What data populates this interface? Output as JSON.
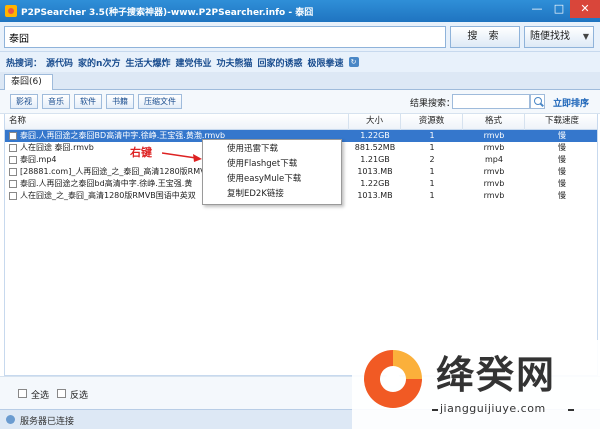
{
  "window": {
    "title": "P2PSearcher 3.5(种子搜索神器)-www.P2PSearcher.info - 泰囧"
  },
  "search": {
    "value": "泰囧",
    "search_label": "搜 索",
    "random_label": "随便找找"
  },
  "hot": {
    "label": "热搜词：",
    "items": [
      "源代码",
      "家的n次方",
      "生活大爆炸",
      "建党伟业",
      "功夫熊猫",
      "回家的诱惑",
      "极限拳速"
    ]
  },
  "tabs": [
    {
      "label": "泰囧(6)"
    }
  ],
  "filters": [
    "影视",
    "音乐",
    "软件",
    "书籍",
    "压缩文件"
  ],
  "result_search": {
    "label": "结果搜索：",
    "sort_label": "立即排序"
  },
  "table": {
    "headers": {
      "name": "名称",
      "size": "大小",
      "sources": "资源数",
      "format": "格式",
      "speed": "下载速度"
    },
    "rows": [
      {
        "name": "泰囧.人再囧途之泰囧BD高清中字.徐峥.王宝强.黄渤.rmvb",
        "size": "1.22GB",
        "sources": "1",
        "format": "rmvb",
        "speed": "慢",
        "selected": true
      },
      {
        "name": "人在囧途 泰囧.rmvb",
        "size": "881.52MB",
        "sources": "1",
        "format": "rmvb",
        "speed": "慢",
        "selected": false
      },
      {
        "name": "泰囧.mp4",
        "size": "1.21GB",
        "sources": "2",
        "format": "mp4",
        "speed": "慢",
        "selected": false
      },
      {
        "name": "[28881.com]_人再囧途_之_泰囧_高清1280版RMV",
        "size": "1013.MB",
        "sources": "1",
        "format": "rmvb",
        "speed": "慢",
        "selected": false
      },
      {
        "name": "泰囧.人再囧途之泰囧bd高清中字.徐峥.王宝强.黄",
        "size": "1.22GB",
        "sources": "1",
        "format": "rmvb",
        "speed": "慢",
        "selected": false
      },
      {
        "name": "人在囧途_之_泰囧_高清1280版RMVB国语中英双",
        "size": "1013.MB",
        "sources": "1",
        "format": "rmvb",
        "speed": "慢",
        "selected": false
      }
    ]
  },
  "context_menu": {
    "items": [
      "使用迅雷下载",
      "使用Flashget下载",
      "使用easyMule下载",
      "复制ED2K链接"
    ]
  },
  "annotation": {
    "text": "右键"
  },
  "bottom": {
    "select_all": "全选",
    "invert": "反选"
  },
  "status": {
    "text": "服务器已连接"
  },
  "watermark": {
    "name": "绛癸网",
    "url": "jiangguijiuye.com"
  }
}
